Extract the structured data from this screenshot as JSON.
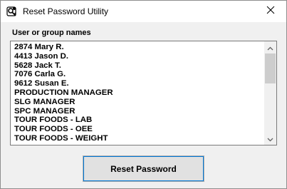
{
  "window": {
    "title": "Reset Password Utility"
  },
  "icons": {
    "app": "keys-app-icon",
    "close": "close-icon",
    "scroll_up": "scroll-up-arrow-icon",
    "scroll_down": "scroll-down-arrow-icon"
  },
  "list": {
    "label": "User or group names",
    "items": [
      "2874 Mary R.",
      "4413 Jason D.",
      "5628 Jack T.",
      "7076 Carla G.",
      "9612 Susan E.",
      "PRODUCTION MANAGER",
      "SLG MANAGER",
      "SPC MANAGER",
      "TOUR FOODS - LAB",
      "TOUR FOODS - OEE",
      "TOUR FOODS - WEIGHT"
    ]
  },
  "actions": {
    "reset_label": "Reset Password"
  },
  "colors": {
    "titlebar_bg": "#ffffff",
    "window_bg": "#f0f0f0",
    "focus_accent": "#0078d7"
  }
}
